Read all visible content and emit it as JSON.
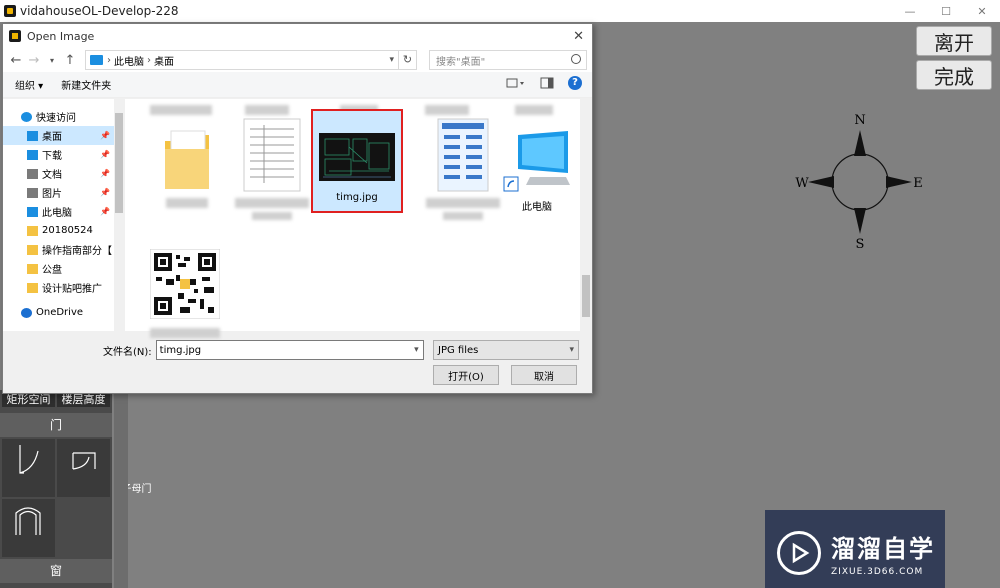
{
  "app": {
    "title": "vidahouseOL-Develop-228",
    "minimize": "—",
    "maximize": "☐",
    "close": "✕"
  },
  "actions": {
    "leave_label": "离开",
    "done_label": "完成"
  },
  "compass": {
    "n": "N",
    "s": "S",
    "e": "E",
    "w": "W"
  },
  "tool_panel": {
    "tabs": [
      "矩形空间",
      "楼层高度"
    ],
    "door_section": "门",
    "door_items": [
      "门",
      "子母门",
      "门洞",
      ""
    ],
    "window_section": "窗"
  },
  "watermark": {
    "title": "溜溜自学",
    "subtitle": "ZIXUE.3D66.COM"
  },
  "dialog": {
    "title": "Open Image",
    "close": "✕",
    "address": {
      "root": "此电脑",
      "current": "桌面"
    },
    "search_placeholder": "搜索\"桌面\"",
    "commands": {
      "organize": "组织 ▾",
      "new_folder": "新建文件夹"
    },
    "nav_items": [
      {
        "label": "快速访问",
        "icon": "star-icon",
        "color": "#1b8ee0"
      },
      {
        "label": "桌面",
        "icon": "desktop-icon",
        "color": "#1b8ee0",
        "pinned": true,
        "selected": true
      },
      {
        "label": "下载",
        "icon": "download-icon",
        "color": "#1b8ee0",
        "pinned": true
      },
      {
        "label": "文档",
        "icon": "document-icon",
        "color": "#7a7a7a",
        "pinned": true
      },
      {
        "label": "图片",
        "icon": "picture-icon",
        "color": "#7a7a7a",
        "pinned": true
      },
      {
        "label": "此电脑",
        "icon": "computer-icon",
        "color": "#1b8ee0",
        "pinned": true
      },
      {
        "label": "20180524",
        "icon": "folder-icon",
        "color": "#f4c242"
      },
      {
        "label": "操作指南部分【",
        "icon": "folder-icon",
        "color": "#f4c242"
      },
      {
        "label": "公盘",
        "icon": "folder-icon",
        "color": "#f4c242"
      },
      {
        "label": "设计贴吧推广",
        "icon": "folder-icon",
        "color": "#f4c242"
      },
      {
        "label": "OneDrive",
        "icon": "cloud-icon",
        "color": "#1b6fd1"
      }
    ],
    "files": [
      {
        "name": "timg.jpg",
        "selected": true
      },
      {
        "name": "此电脑"
      }
    ],
    "filename_label": "文件名(N):",
    "filename_value": "timg.jpg",
    "filetype": "JPG files",
    "open_button": "打开(O)",
    "cancel_button": "取消"
  }
}
